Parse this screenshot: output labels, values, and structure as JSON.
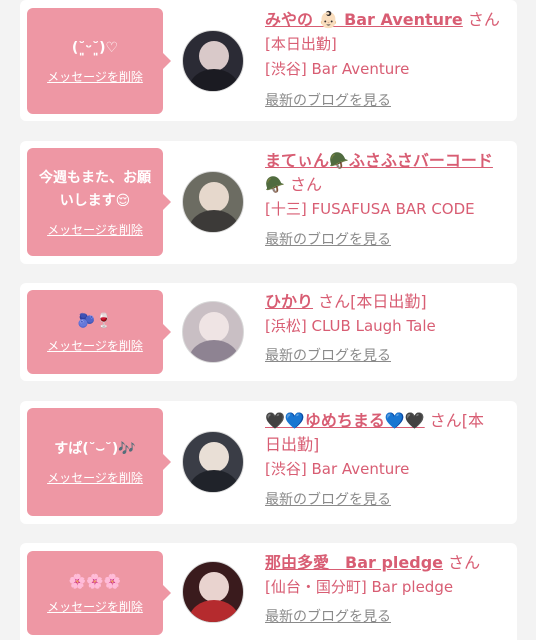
{
  "cards": [
    {
      "message": "(˘͈ᵕ˘͈)♡",
      "delete_label": "メッセージを削除",
      "name": "みやの 👶🏻 Bar Aventure",
      "san": "さん",
      "shop": "[本日出勤]",
      "shop2": "[渋谷] Bar Aventure",
      "blog": "最新のブログを見る"
    },
    {
      "message": "今週もまた、お願いします😌",
      "delete_label": "メッセージを削除",
      "name": "まてぃん🪖ふさふさバーコード",
      "name2": "🪖",
      "san": "さん",
      "shop": "[十三] FUSAFUSA BAR CODE",
      "blog": "最新のブログを見る"
    },
    {
      "message": "🫐🍷",
      "delete_label": "メッセージを削除",
      "name": "ひかり",
      "san": "さん[本日出勤]",
      "shop": "[浜松] CLUB Laugh Tale",
      "blog": "最新のブログを見る"
    },
    {
      "message": "すぱ(˘⌣˘)🎶",
      "delete_label": "メッセージを削除",
      "name": "🖤💙ゆめちまる💙🖤",
      "san": "さん[本",
      "san2": "日出勤]",
      "shop": "[渋谷] Bar Aventure",
      "blog": "最新のブログを見る"
    },
    {
      "message": "🌸🌸🌸",
      "delete_label": "メッセージを削除",
      "name": "那由多愛　Bar pledge",
      "san": "さん",
      "shop": "[仙台・国分町] Bar pledge",
      "blog": "最新のブログを見る"
    }
  ]
}
